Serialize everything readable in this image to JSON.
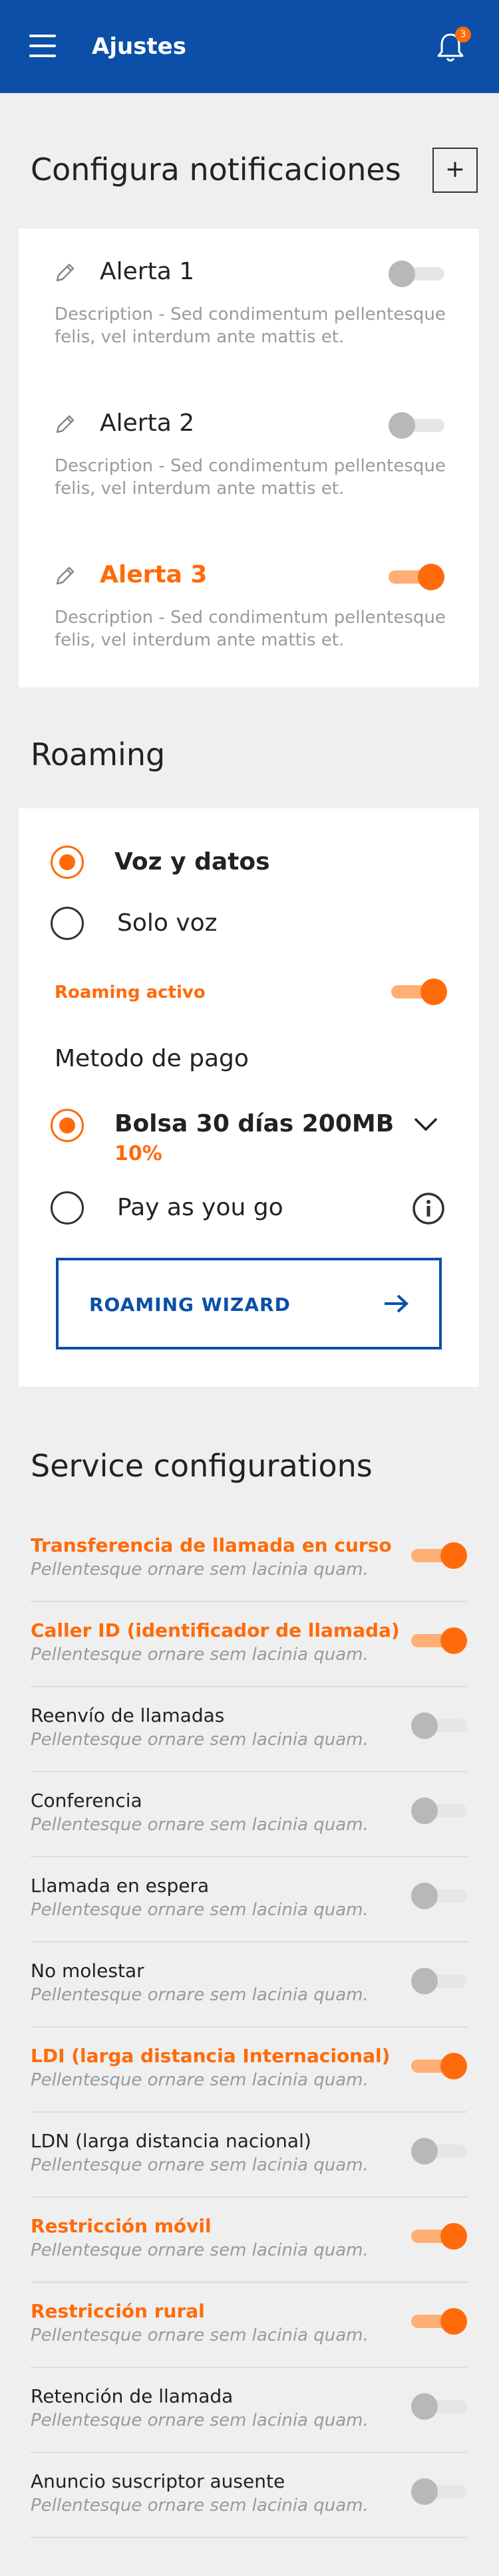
{
  "header": {
    "title": "Ajustes",
    "notification_count": "3"
  },
  "notifications": {
    "title": "Configura notificaciones",
    "add_label": "+",
    "alerts": [
      {
        "name": "Alerta 1",
        "desc": "Description - Sed condimentum pellentesque felis, vel interdum ante mattis et.",
        "active": false
      },
      {
        "name": "Alerta 2",
        "desc": "Description - Sed condimentum pellentesque felis, vel interdum ante mattis et.",
        "active": false
      },
      {
        "name": "Alerta 3",
        "desc": "Description - Sed condimentum pellentesque felis, vel interdum ante mattis et.",
        "active": true
      }
    ]
  },
  "roaming": {
    "title": "Roaming",
    "option_voice_data": "Voz y datos",
    "option_voice_only": "Solo voz",
    "active_label": "Roaming activo",
    "payment_title": "Metodo de pago",
    "payment_bolsa": "Bolsa 30 días 200MB",
    "payment_bolsa_percent": "10%",
    "payment_payg": "Pay as you go",
    "wizard_label": "ROAMING WIZARD"
  },
  "services": {
    "title": "Service configurations",
    "items": [
      {
        "title": "Transferencia de llamada en curso",
        "sub": "Pellentesque ornare sem lacinia quam.",
        "on": true
      },
      {
        "title": "Caller ID (identificador de llamada)",
        "sub": "Pellentesque ornare sem lacinia quam.",
        "on": true
      },
      {
        "title": "Reenvío de llamadas",
        "sub": "Pellentesque ornare sem lacinia quam.",
        "on": false
      },
      {
        "title": "Conferencia",
        "sub": "Pellentesque ornare sem lacinia quam.",
        "on": false
      },
      {
        "title": "Llamada en espera",
        "sub": "Pellentesque ornare sem lacinia quam.",
        "on": false
      },
      {
        "title": "No molestar",
        "sub": "Pellentesque ornare sem lacinia quam.",
        "on": false
      },
      {
        "title": "LDI (larga distancia Internacional)",
        "sub": "Pellentesque ornare sem lacinia quam.",
        "on": true
      },
      {
        "title": "LDN (larga distancia nacional)",
        "sub": "Pellentesque ornare sem lacinia quam.",
        "on": false
      },
      {
        "title": "Restricción móvil",
        "sub": "Pellentesque ornare sem lacinia quam.",
        "on": true
      },
      {
        "title": "Restricción rural",
        "sub": "Pellentesque ornare sem lacinia quam.",
        "on": true
      },
      {
        "title": "Retención de llamada",
        "sub": "Pellentesque ornare sem lacinia quam.",
        "on": false
      },
      {
        "title": "Anuncio suscriptor ausente",
        "sub": "Pellentesque ornare sem lacinia quam.",
        "on": false
      }
    ]
  }
}
